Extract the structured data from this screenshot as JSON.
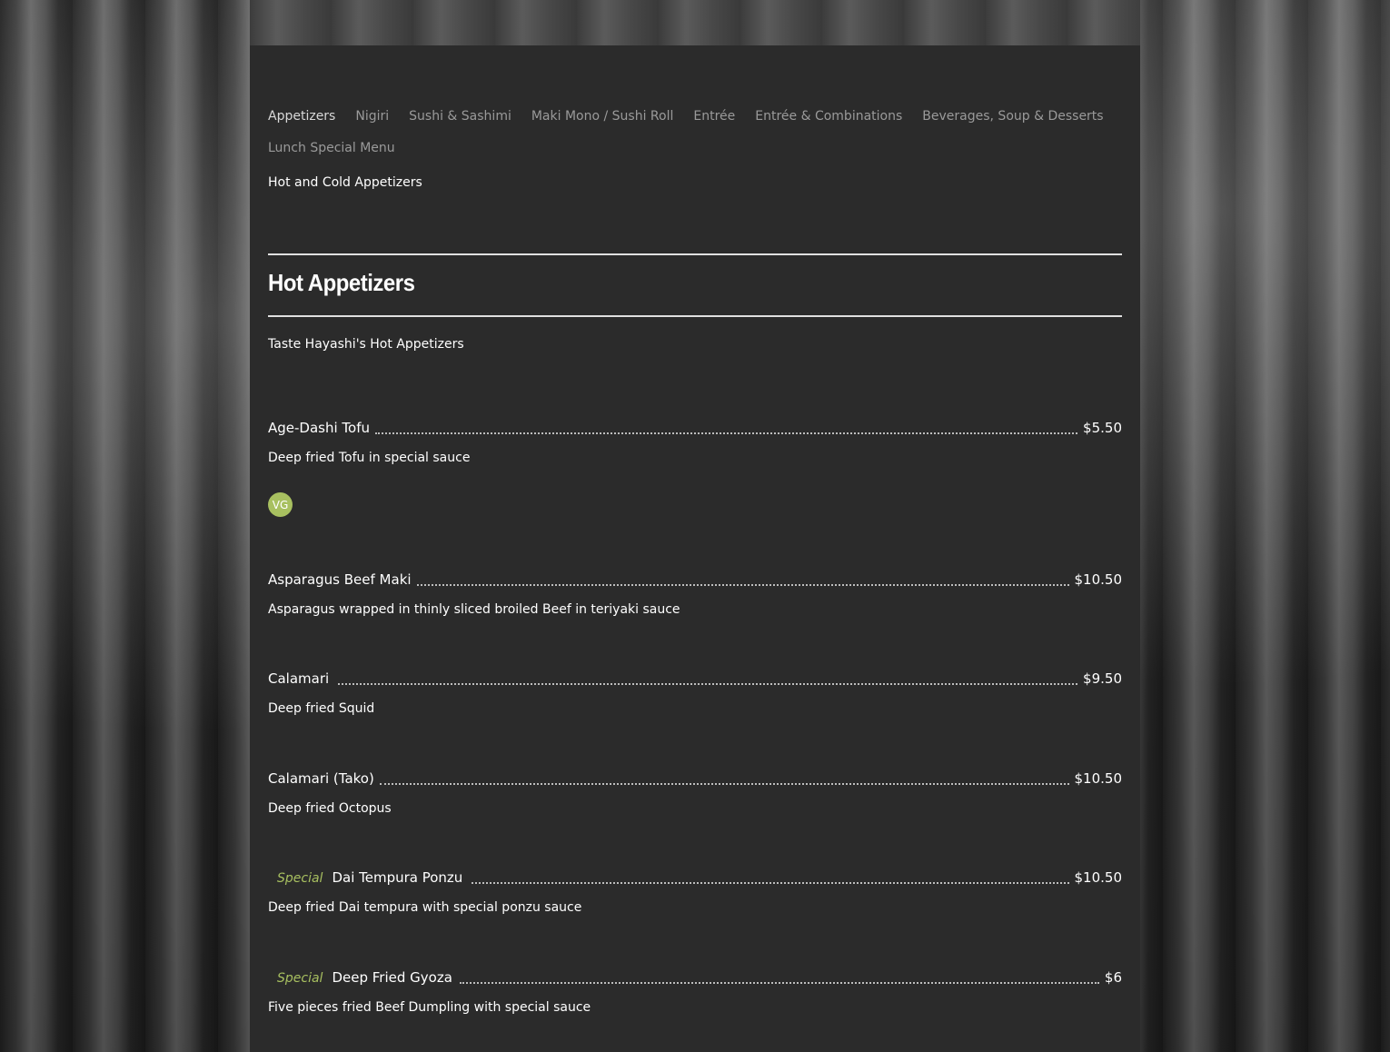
{
  "nav": {
    "tabs": [
      {
        "label": "Appetizers"
      },
      {
        "label": "Nigiri"
      },
      {
        "label": "Sushi & Sashimi"
      },
      {
        "label": "Maki Mono / Sushi Roll"
      },
      {
        "label": "Entrée"
      },
      {
        "label": "Entrée & Combinations"
      },
      {
        "label": "Beverages, Soup & Desserts"
      },
      {
        "label": "Lunch Special Menu"
      }
    ],
    "active_index": 0
  },
  "menu": {
    "description": "Hot and Cold Appetizers",
    "section_title": "Hot Appetizers",
    "section_tagline": "Taste Hayashi's Hot Appetizers",
    "items": [
      {
        "special": "",
        "name": "Age-Dashi Tofu",
        "price": "$5.50",
        "description": "Deep fried Tofu in special sauce",
        "badge": "VG"
      },
      {
        "special": "",
        "name": "Asparagus Beef Maki",
        "price": "$10.50",
        "description": "Asparagus wrapped in thinly sliced broiled Beef in teriyaki sauce"
      },
      {
        "special": "",
        "name": "Calamari",
        "price": "$9.50",
        "description": "Deep fried Squid"
      },
      {
        "special": "",
        "name": "Calamari (Tako)",
        "price": "$10.50",
        "description": "Deep fried Octopus"
      },
      {
        "special": "Special",
        "name": "Dai Tempura Ponzu",
        "price": "$10.50",
        "description": "Deep fried Dai tempura with special ponzu sauce"
      },
      {
        "special": "Special",
        "name": "Deep Fried Gyoza",
        "price": "$6",
        "description": "Five pieces fried Beef Dumpling with special sauce"
      }
    ]
  },
  "colors": {
    "panel": "#2b2b2b",
    "accent_green": "#a8c060",
    "tab_inactive": "#9a9a9a",
    "text": "#ffffff"
  }
}
